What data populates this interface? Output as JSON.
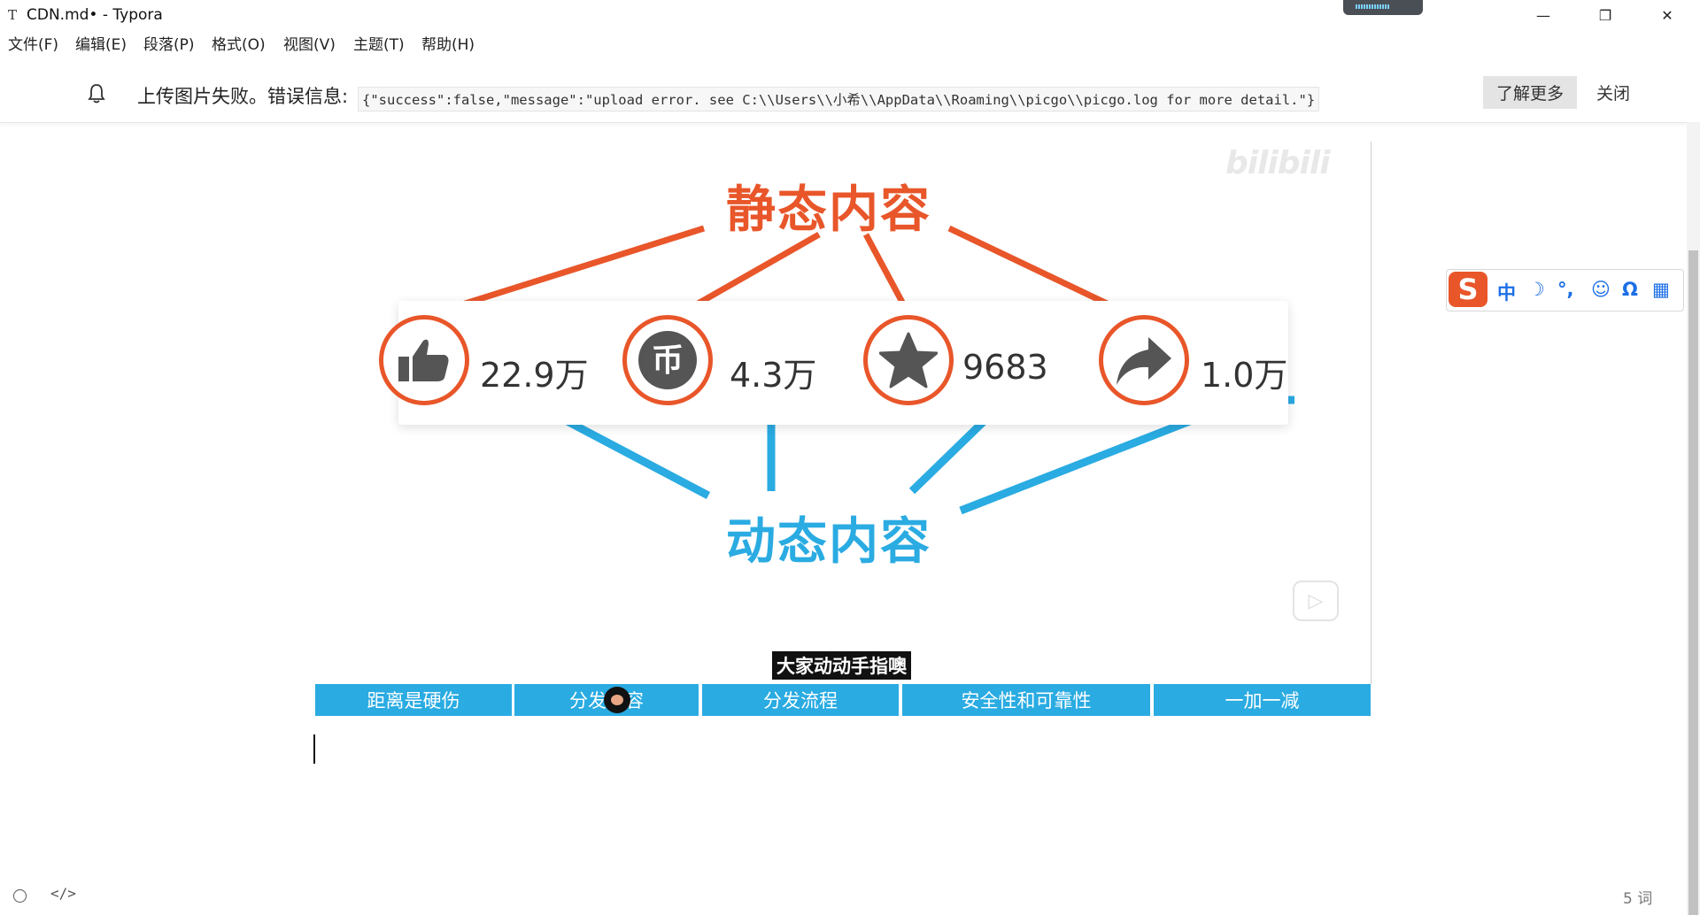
{
  "window": {
    "app_icon": "T",
    "title": "CDN.md• - Typora",
    "min_icon": "—",
    "max_icon": "❐",
    "close_icon": "✕"
  },
  "menu": [
    {
      "label": "文件(F)"
    },
    {
      "label": "编辑(E)"
    },
    {
      "label": "段落(P)"
    },
    {
      "label": "格式(O)"
    },
    {
      "label": "视图(V)"
    },
    {
      "label": "主题(T)"
    },
    {
      "label": "帮助(H)"
    }
  ],
  "notification": {
    "message": "上传图片失败。错误信息:",
    "code": "{\"success\":false,\"message\":\"upload error. see C:\\\\Users\\\\小希\\\\AppData\\\\Roaming\\\\picgo\\\\picgo.log for more detail.\"}",
    "learn_more": "了解更多",
    "close": "关闭"
  },
  "video": {
    "watermark": "bilibili",
    "static_label": "静态内容",
    "dynamic_label": "动态内容",
    "stats": [
      {
        "icon": "thumbs-up-icon",
        "value": "22.9万"
      },
      {
        "icon": "coin-icon",
        "value": "4.3万"
      },
      {
        "icon": "star-icon",
        "value": "9683"
      },
      {
        "icon": "share-icon",
        "value": "1.0万"
      }
    ],
    "caption": "大家动动手指噢",
    "chapters": [
      {
        "label": "距离是硬伤"
      },
      {
        "label": "分发内容"
      },
      {
        "label": "分发流程"
      },
      {
        "label": "安全性和可靠性"
      },
      {
        "label": "一加一减"
      }
    ],
    "accent_orange": "#e8562a",
    "accent_blue": "#2aabe2"
  },
  "ime": {
    "logo": "S",
    "items": [
      "中",
      "☽",
      "°,",
      "☺",
      "Ω",
      "▦"
    ]
  },
  "status": {
    "word_count": "5 词",
    "source_icon": "</>"
  }
}
